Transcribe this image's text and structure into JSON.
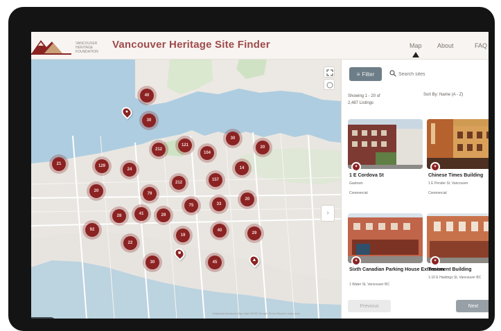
{
  "header": {
    "title": "Vancouver Heritage Site Finder",
    "logo_text": "VANCOUVER HERITAGE FOUNDATION",
    "nav": {
      "map": "Map",
      "about": "About",
      "faq": "FAQ"
    }
  },
  "map": {
    "clusters": [
      "40",
      "30",
      "30",
      "20",
      "121",
      "212",
      "104",
      "129",
      "21",
      "14",
      "24",
      "212",
      "157",
      "79",
      "20",
      "20",
      "75",
      "33",
      "28",
      "41",
      "29",
      "92",
      "40",
      "29",
      "19",
      "22",
      "30",
      "45"
    ],
    "attribution": "Keyboard shortcuts   Map data ©2022 Google   Terms   Report a map error"
  },
  "panel": {
    "filter_label": "Filter",
    "search_placeholder": "Search sites",
    "results_line1": "Showing 1 - 20 of",
    "results_line2": "2,487 Listings",
    "sort_label": "Sort By:",
    "sort_value": "Name (A - Z)",
    "cards": [
      {
        "title": "1 E Cordova St",
        "addr": "Gastown",
        "type": "Commercial"
      },
      {
        "title": "Chinese Times Building",
        "addr": "1 E Pender St, Vancouver",
        "type": "Commercial"
      },
      {
        "title": "Sixth Canadian Parking House Extension",
        "addr": "1 Water St, Vancouver BC",
        "type": ""
      },
      {
        "title": "Tenement Building",
        "addr": "1-10 E Hastings St, Vancouver BC",
        "type": ""
      }
    ],
    "prev_label": "Previous",
    "next_label": "Next"
  },
  "colors": {
    "brand": "#9e4a4a",
    "cluster": "#8b2323",
    "water": "#aecde0",
    "land": "#e9e6e1",
    "park": "#cfe3c4"
  }
}
